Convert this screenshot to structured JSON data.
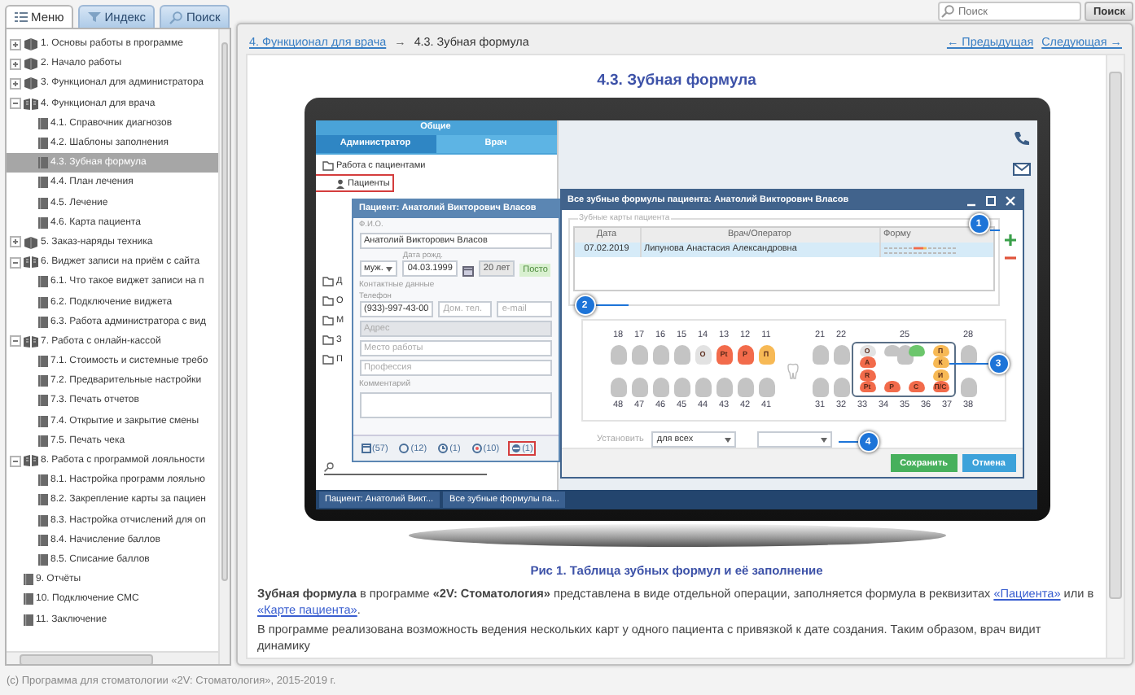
{
  "sidebar": {
    "tabs": [
      {
        "label": "Меню",
        "selected": true
      },
      {
        "label": "Индекс",
        "selected": false
      },
      {
        "label": "Поиск",
        "selected": false
      }
    ],
    "tree": [
      {
        "label": "1. Основы работы в программе",
        "kind": "chapter",
        "expanded": false,
        "selected": false
      },
      {
        "label": "2. Начало работы",
        "kind": "chapter",
        "expanded": false,
        "selected": false
      },
      {
        "label": "3. Функционал для администратора",
        "kind": "chapter",
        "expanded": false,
        "selected": false
      },
      {
        "label": "4. Функционал для врача",
        "kind": "chapter",
        "expanded": true,
        "selected": false,
        "children": [
          {
            "label": "4.1. Справочник диагнозов",
            "kind": "page",
            "selected": false
          },
          {
            "label": "4.2. Шаблоны заполнения",
            "kind": "page",
            "selected": false
          },
          {
            "label": "4.3. Зубная формула",
            "kind": "page",
            "selected": true
          },
          {
            "label": "4.4. План лечения",
            "kind": "page",
            "selected": false
          },
          {
            "label": "4.5. Лечение",
            "kind": "page",
            "selected": false
          },
          {
            "label": "4.6. Карта пациента",
            "kind": "page",
            "selected": false
          }
        ]
      },
      {
        "label": "5. Заказ-наряды техника",
        "kind": "chapter",
        "expanded": false,
        "selected": false
      },
      {
        "label": "6. Виджет записи на приём с сайта",
        "kind": "chapter",
        "expanded": true,
        "selected": false,
        "children": [
          {
            "label": "6.1. Что такое виджет записи на п",
            "kind": "page",
            "selected": false
          },
          {
            "label": "6.2. Подключение виджета",
            "kind": "page",
            "selected": false
          },
          {
            "label": "6.3. Работа администратора с вид",
            "kind": "page",
            "selected": false
          }
        ]
      },
      {
        "label": "7. Работа с онлайн-кассой",
        "kind": "chapter",
        "expanded": true,
        "selected": false,
        "children": [
          {
            "label": "7.1. Стоимость и системные требо",
            "kind": "page",
            "selected": false
          },
          {
            "label": "7.2. Предварительные настройки",
            "kind": "page",
            "selected": false
          },
          {
            "label": "7.3. Печать отчетов",
            "kind": "page",
            "selected": false
          },
          {
            "label": "7.4. Открытие и закрытие смены",
            "kind": "page",
            "selected": false
          },
          {
            "label": "7.5. Печать чека",
            "kind": "page",
            "selected": false
          }
        ]
      },
      {
        "label": "8. Работа с программой лояльности",
        "kind": "chapter",
        "expanded": true,
        "selected": false,
        "children": [
          {
            "label": "8.1. Настройка программ лояльно",
            "kind": "page",
            "selected": false
          },
          {
            "label": "8.2. Закрепление карты за пациен",
            "kind": "page",
            "selected": false
          },
          {
            "label": "8.3. Настройка отчислений для оп",
            "kind": "page",
            "selected": false
          },
          {
            "label": "8.4. Начисление баллов",
            "kind": "page",
            "selected": false
          },
          {
            "label": "8.5. Списание баллов",
            "kind": "page",
            "selected": false
          }
        ]
      },
      {
        "label": "9. Отчёты",
        "kind": "page",
        "selected": false
      },
      {
        "label": "10. Подключение СМС",
        "kind": "page",
        "selected": false
      },
      {
        "label": "11. Заключение",
        "kind": "page",
        "selected": false
      }
    ]
  },
  "search": {
    "placeholder": "Поиск",
    "button": "Поиск"
  },
  "breadcrumb": {
    "parent": "4. Функционал для врача",
    "separator": "→",
    "current": "4.3. Зубная формула",
    "prev": "← Предыдущая",
    "next": "Следующая →"
  },
  "article": {
    "title": "4.3. Зубная формула",
    "figure": {
      "caption": "Рис 1. Таблица зубных формул и её заполнение",
      "screen": {
        "tabs_top": "Общие",
        "tabs": [
          {
            "label": "Администратор",
            "selected": true
          },
          {
            "label": "Врач",
            "selected": false
          }
        ],
        "tree": [
          {
            "label": "Работа с пациентами",
            "highlighted": false
          },
          {
            "label": "Пациенты",
            "highlighted": true
          }
        ],
        "folders": [
          "Д",
          "О",
          "М",
          "З",
          "П"
        ],
        "patient_dialog": {
          "title": "Пациент: Анатолий Викторович Власов",
          "fio_label": "Ф.И.О.",
          "fio": "Анатолий Викторович Власов",
          "gender": "муж.",
          "birth_label": "Дата рожд.",
          "birth": "04.03.1999",
          "age": "20 лет",
          "status": "Посто",
          "contacts_label": "Контактные данные",
          "phone_label": "Телефон",
          "phone": "(933)-997-43-00",
          "home_phone": "Дом. тел.",
          "email": "e-mail",
          "address": "Адрес",
          "work": "Место работы",
          "profession": "Профессия",
          "comment_label": "Комментарий",
          "counters": [
            {
              "count": "(57)",
              "highlighted": false
            },
            {
              "count": "(12)",
              "highlighted": false
            },
            {
              "count": "(1)",
              "highlighted": false
            },
            {
              "count": "(10)",
              "highlighted": false
            },
            {
              "count": "(1)",
              "highlighted": true
            }
          ]
        },
        "formulas_dialog": {
          "title": "Все зубные формулы пациента: Анатолий Викторович Власов",
          "group": "Зубные карты пациента",
          "columns": [
            "Дата",
            "Врач/Оператор",
            "Форму"
          ],
          "rows": [
            {
              "date": "07.02.2019",
              "doctor": "Липунова Анастасия Александровна",
              "selected": true
            }
          ],
          "upper_left": [
            {
              "number": "18",
              "color": "#c4c4c4"
            },
            {
              "number": "17",
              "color": "#c4c4c4"
            },
            {
              "number": "16",
              "color": "#c4c4c4"
            },
            {
              "number": "15",
              "color": "#c4c4c4"
            },
            {
              "number": "14",
              "mark": "О",
              "color": "#e2e2e2"
            },
            {
              "number": "13",
              "mark": "Pt",
              "color": "#f26b4b"
            },
            {
              "number": "12",
              "mark": "P",
              "color": "#f26b4b"
            },
            {
              "number": "11",
              "mark": "П",
              "color": "#f7b955"
            }
          ],
          "upper_right": [
            {
              "number": "21",
              "color": "#c4c4c4"
            },
            {
              "number": "22",
              "color": "#c4c4c4"
            },
            {
              "covered": true
            },
            {
              "covered": true
            },
            {
              "number": "25",
              "color": "#c4c4c4"
            },
            {
              "covered": true
            },
            {
              "covered": true
            },
            {
              "number": "28",
              "color": "#c4c4c4"
            }
          ],
          "lower_left": [
            {
              "number": "48",
              "color": "#c4c4c4"
            },
            {
              "number": "47",
              "color": "#c4c4c4"
            },
            {
              "number": "46",
              "color": "#c4c4c4"
            },
            {
              "number": "45",
              "color": "#c4c4c4"
            },
            {
              "number": "44",
              "color": "#c4c4c4"
            },
            {
              "number": "43",
              "color": "#c4c4c4"
            },
            {
              "number": "42",
              "color": "#c4c4c4"
            },
            {
              "number": "41",
              "color": "#c4c4c4"
            }
          ],
          "lower_right": [
            {
              "number": "31",
              "color": "#c4c4c4"
            },
            {
              "number": "32",
              "color": "#c4c4c4"
            },
            {
              "number": "33",
              "covered": true
            },
            {
              "number": "34",
              "covered": true
            },
            {
              "number": "35",
              "covered": true
            },
            {
              "number": "36",
              "covered": true
            },
            {
              "number": "37",
              "covered": true
            },
            {
              "number": "38",
              "color": "#c4c4c4"
            }
          ],
          "palette": [
            [
              {
                "kind": "tooth",
                "mark": "О",
                "color": "#e2e2e2"
              },
              {
                "kind": "tooth",
                "color": "#c4c4c4"
              },
              {
                "kind": "tooth",
                "color": "#6cc66c"
              },
              {
                "kind": "tooth",
                "mark": "П",
                "color": "#f7b955"
              }
            ],
            [
              {
                "kind": "tooth",
                "mark": "А",
                "color": "#f26b4b"
              },
              {
                "kind": "gap"
              },
              {
                "kind": "gap"
              },
              {
                "kind": "tooth",
                "mark": "К",
                "color": "#f7b955"
              }
            ],
            [
              {
                "kind": "tooth",
                "mark": "R",
                "color": "#f26b4b"
              },
              {
                "kind": "gap"
              },
              {
                "kind": "gap"
              },
              {
                "kind": "tooth",
                "mark": "И",
                "color": "#f7b955"
              }
            ],
            [
              {
                "kind": "tooth",
                "mark": "Pt",
                "color": "#f26b4b"
              },
              {
                "kind": "tooth",
                "mark": "Р",
                "color": "#f26b4b"
              },
              {
                "kind": "tooth",
                "mark": "С",
                "color": "#f26b4b"
              },
              {
                "kind": "tooth",
                "mark": "П/С",
                "color": "#f26b4b"
              }
            ]
          ],
          "set_label": "Установить",
          "set_value": "для всех",
          "save": "Сохранить",
          "cancel": "Отмена"
        },
        "callouts": [
          "1",
          "2",
          "3",
          "4"
        ],
        "taskbar": [
          "Пациент: Анатолий Викт...",
          "Все зубные формулы па..."
        ]
      }
    },
    "paragraphs": [
      [
        {
          "kind": "text",
          "text": "**Зубная формула** в программе **«2V: Стоматология»** представлена в виде отдельной операции, заполняется формула в реквизитах "
        },
        {
          "kind": "link",
          "text": "«Пациента»"
        },
        {
          "kind": "text",
          "text": " или в "
        },
        {
          "kind": "link",
          "text": "«Карте пациента»"
        },
        {
          "kind": "text",
          "text": "."
        }
      ],
      [
        {
          "kind": "text",
          "text": "В программе реализована возможность ведения нескольких карт у одного пациента с привязкой к дате создания. Таким образом, врач видит динамику"
        }
      ]
    ]
  },
  "footer": "(c) Программа для стоматологии «2V: Стоматология», 2015-2019 г."
}
